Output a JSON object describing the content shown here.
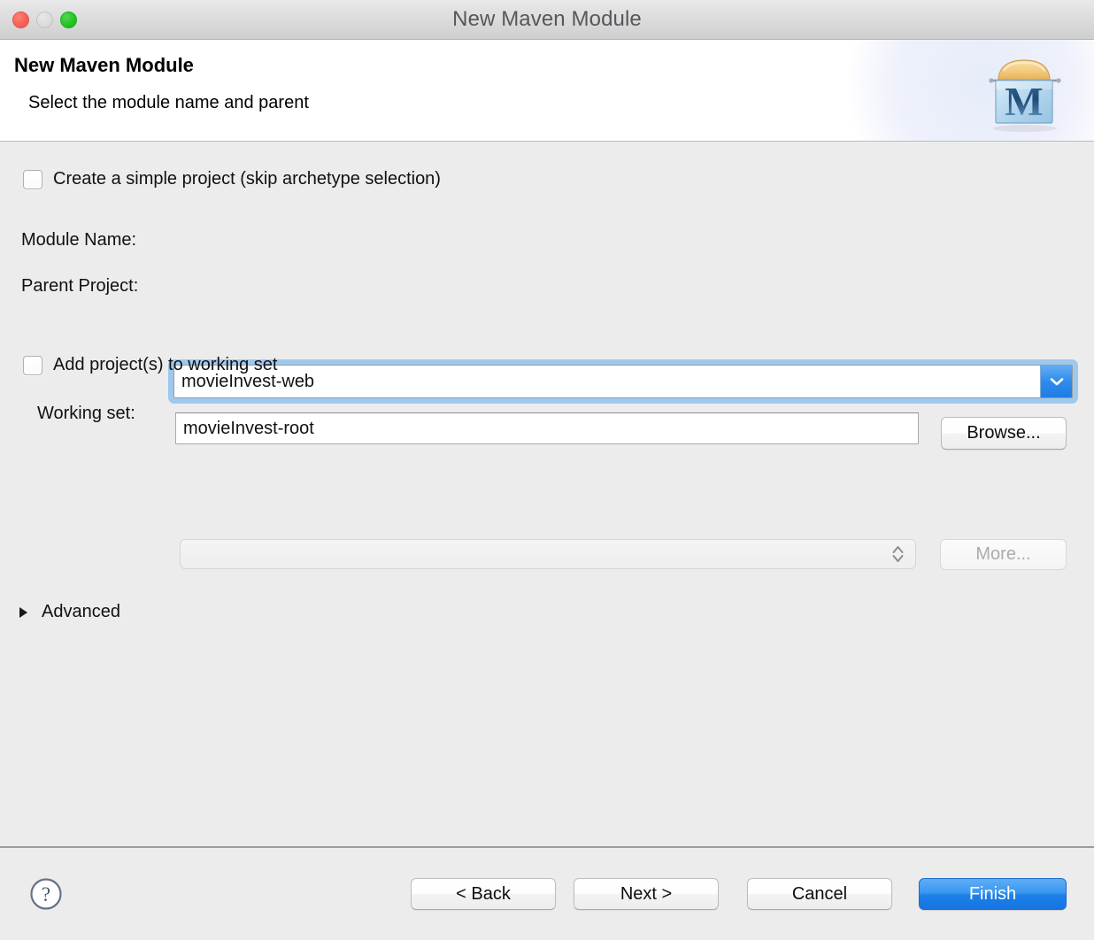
{
  "window": {
    "title": "New Maven Module",
    "controls": {
      "close": "close-button",
      "minimize": "minimize-button",
      "maximize": "maximize-button"
    }
  },
  "header": {
    "title": "New Maven Module",
    "subtitle": "Select the module name and parent",
    "icon_letter": "M",
    "icon_name": "maven-module-icon"
  },
  "form": {
    "simple_project": {
      "label": "Create a simple project (skip archetype selection)",
      "checked": false
    },
    "module_name": {
      "label": "Module Name:",
      "value": "movieInvest-web",
      "placeholder": "",
      "focused": true,
      "dropdown_icon": "chevron-down-icon"
    },
    "parent_project": {
      "label": "Parent Project:",
      "value": "movieInvest-root",
      "placeholder": "",
      "browse_label": "Browse..."
    },
    "add_to_working_set": {
      "label": "Add project(s) to working set",
      "checked": false
    },
    "working_set": {
      "label": "Working set:",
      "value": "",
      "placeholder": "",
      "disabled": true,
      "stepper_icon": "up-down-chevron-icon",
      "more_label": "More...",
      "more_disabled": true
    },
    "advanced": {
      "label": "Advanced",
      "expanded": false,
      "disclosure_icon": "triangle-right-icon"
    }
  },
  "footer": {
    "help_icon": "question-mark-help-icon",
    "back_label": "< Back",
    "next_label": "Next >",
    "cancel_label": "Cancel",
    "finish_label": "Finish"
  },
  "colors": {
    "accent_blue": "#2f8bec",
    "focus_ring": "#9ec9ef",
    "window_bg": "#ececec",
    "header_bg": "#ffffff",
    "titlebar_bg": "#dadada",
    "close_red": "#fa6058",
    "minimize_gray": "#dcdcdc",
    "maximize_green": "#23c423"
  }
}
